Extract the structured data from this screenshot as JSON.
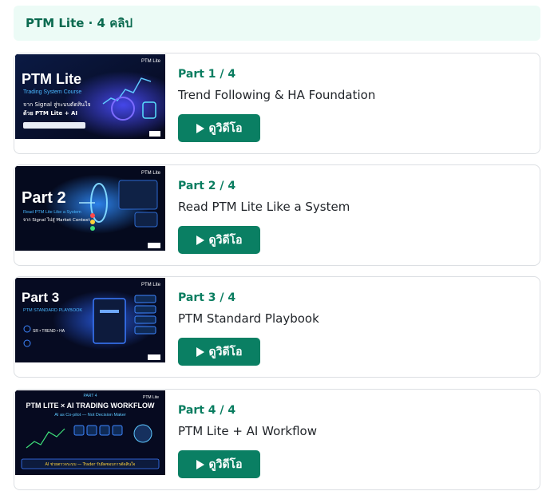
{
  "header": {
    "title": "PTM Lite · 4 คลิป"
  },
  "colors": {
    "accent": "#0a7f63",
    "header_bg": "#ecfbf6",
    "header_text": "#0a6a4f"
  },
  "cards": [
    {
      "part": "Part 1 / 4",
      "title": "Trend Following & HA Foundation",
      "button": "ดูวิดีโอ",
      "thumb": {
        "brand": "PTM Lite",
        "headline": "PTM Lite",
        "subhead": "Trading System Course",
        "line1": "จาก Signal สู่ระบบตัดสินใจ",
        "line2": "ด้วย PTM Lite + AI"
      }
    },
    {
      "part": "Part 2 / 4",
      "title": "Read PTM Lite Like a System",
      "button": "ดูวิดีโอ",
      "thumb": {
        "brand": "PTM Lite",
        "headline": "Part 2",
        "subhead": "Read PTM Lite Like a System",
        "line1": "จาก Signal ไปสู่ Market Context",
        "line2": ""
      }
    },
    {
      "part": "Part 3 / 4",
      "title": "PTM Standard Playbook",
      "button": "ดูวิดีโอ",
      "thumb": {
        "brand": "PTM Lite",
        "headline": "Part 3",
        "subhead": "PTM STANDARD PLAYBOOK",
        "line1": "SR • TREND • HA",
        "line2": ""
      }
    },
    {
      "part": "Part 4 / 4",
      "title": "PTM Lite + AI Workflow",
      "button": "ดูวิดีโอ",
      "thumb": {
        "brand": "PTM Lite",
        "headline": "PTM LITE × AI TRADING WORKFLOW",
        "subhead": "AI as Co-pilot — Not Decision Maker",
        "line1": "PART 4",
        "line2": "AI ช่วยตรวจระบบ — Trader รับผิดชอบการตัดสินใจ"
      }
    }
  ]
}
